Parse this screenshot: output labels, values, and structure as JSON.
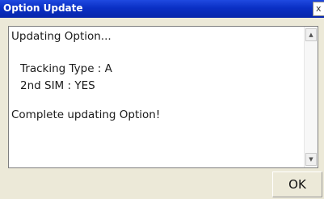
{
  "window": {
    "title": "Option Update",
    "close_label": "x"
  },
  "message": {
    "line1": "Updating Option...",
    "line2": "Tracking Type : A",
    "line3": "2nd SIM : YES",
    "line4": "Complete updating Option!"
  },
  "scrollbar": {
    "up_icon": "▲",
    "down_icon": "▼"
  },
  "buttons": {
    "ok_label": "OK"
  },
  "colors": {
    "titlebar": "#0a2fc4",
    "dialog_bg": "#ece9d8"
  }
}
